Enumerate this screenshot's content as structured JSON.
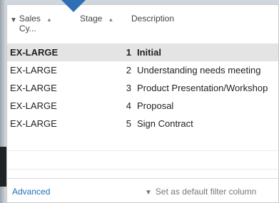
{
  "header": {
    "col1_label_line1": "Sales",
    "col1_label_line2": "Cy...",
    "col2_label": "Stage",
    "col3_label": "Description"
  },
  "rows": [
    {
      "sales_cycle": "EX-LARGE",
      "stage": "1",
      "description": "Initial",
      "selected": true
    },
    {
      "sales_cycle": "EX-LARGE",
      "stage": "2",
      "description": "Understanding needs meeting",
      "selected": false
    },
    {
      "sales_cycle": "EX-LARGE",
      "stage": "3",
      "description": "Product Presentation/Workshop",
      "selected": false
    },
    {
      "sales_cycle": "EX-LARGE",
      "stage": "4",
      "description": "Proposal",
      "selected": false
    },
    {
      "sales_cycle": "EX-LARGE",
      "stage": "5",
      "description": "Sign Contract",
      "selected": false
    }
  ],
  "footer": {
    "advanced_label": "Advanced",
    "set_default_label": "Set as default filter column"
  },
  "icons": {
    "filter": "filter-icon",
    "sort": "sort-ascending-icon",
    "dropdown_pointer": "dropdown-pointer-icon"
  },
  "colors": {
    "accent": "#2f6fb8",
    "link": "#1f6fb5",
    "selected_row": "#e4e4e4"
  }
}
